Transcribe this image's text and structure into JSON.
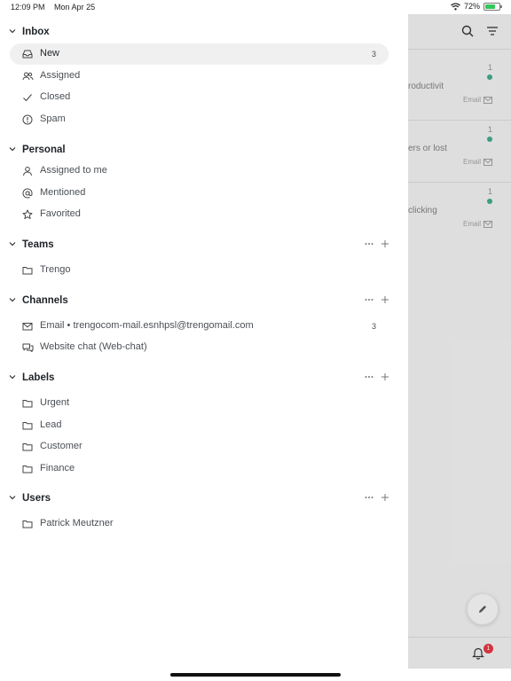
{
  "statusbar": {
    "time": "12:09 PM",
    "date": "Mon Apr 25",
    "battery": "72%",
    "battery_level": 0.72
  },
  "inbox": {
    "title": "Inbox",
    "items": [
      {
        "label": "New",
        "count": "3",
        "icon": "inbox-icon",
        "active": true
      },
      {
        "label": "Assigned",
        "icon": "users-icon"
      },
      {
        "label": "Closed",
        "icon": "check-icon"
      },
      {
        "label": "Spam",
        "icon": "alert-circle-icon"
      }
    ]
  },
  "personal": {
    "title": "Personal",
    "items": [
      {
        "label": "Assigned to me",
        "icon": "user-icon"
      },
      {
        "label": "Mentioned",
        "icon": "at-icon"
      },
      {
        "label": "Favorited",
        "icon": "star-icon"
      }
    ]
  },
  "teams": {
    "title": "Teams",
    "items": [
      {
        "label": "Trengo",
        "icon": "folder-icon"
      }
    ]
  },
  "channels": {
    "title": "Channels",
    "items": [
      {
        "label": "Email • trengocom-mail.esnhpsl@trengomail.com",
        "count": "3",
        "icon": "mail-icon"
      },
      {
        "label": "Website chat (Web-chat)",
        "icon": "chat-icon"
      }
    ]
  },
  "labels": {
    "title": "Labels",
    "items": [
      {
        "label": "Urgent",
        "icon": "folder-icon"
      },
      {
        "label": "Lead",
        "icon": "folder-icon"
      },
      {
        "label": "Customer",
        "icon": "folder-icon"
      },
      {
        "label": "Finance",
        "icon": "folder-icon"
      }
    ]
  },
  "users": {
    "title": "Users",
    "items": [
      {
        "label": "Patrick Meutzner",
        "icon": "folder-icon"
      }
    ]
  },
  "background": {
    "conversations": [
      {
        "count": "1",
        "snippet": "roductivit",
        "channel": "Email"
      },
      {
        "count": "1",
        "snippet": "ers or lost",
        "channel": "Email"
      },
      {
        "count": "1",
        "snippet": "clicking",
        "channel": "Email"
      }
    ],
    "notification_count": "1"
  },
  "colors": {
    "unread_dot": "#3ea287",
    "badge": "#d9363e",
    "active_row": "#f0f0f0"
  }
}
